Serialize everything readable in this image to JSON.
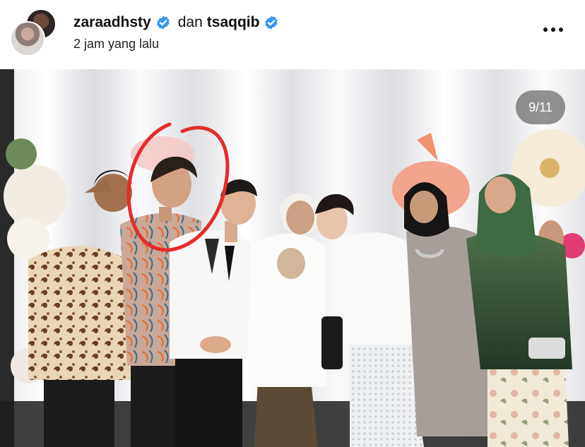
{
  "post": {
    "author_1": "zaraadhsty",
    "connector": "dan",
    "author_2": "tsaqqib",
    "timestamp": "2 jam yang lalu",
    "slide_counter": "9/11"
  },
  "icons": {
    "verified": "verified-badge-icon",
    "more": "more-options-icon"
  },
  "colors": {
    "verified_blue": "#3897f0",
    "annotation_red": "#e52b2b",
    "counter_bg": "#505050"
  }
}
